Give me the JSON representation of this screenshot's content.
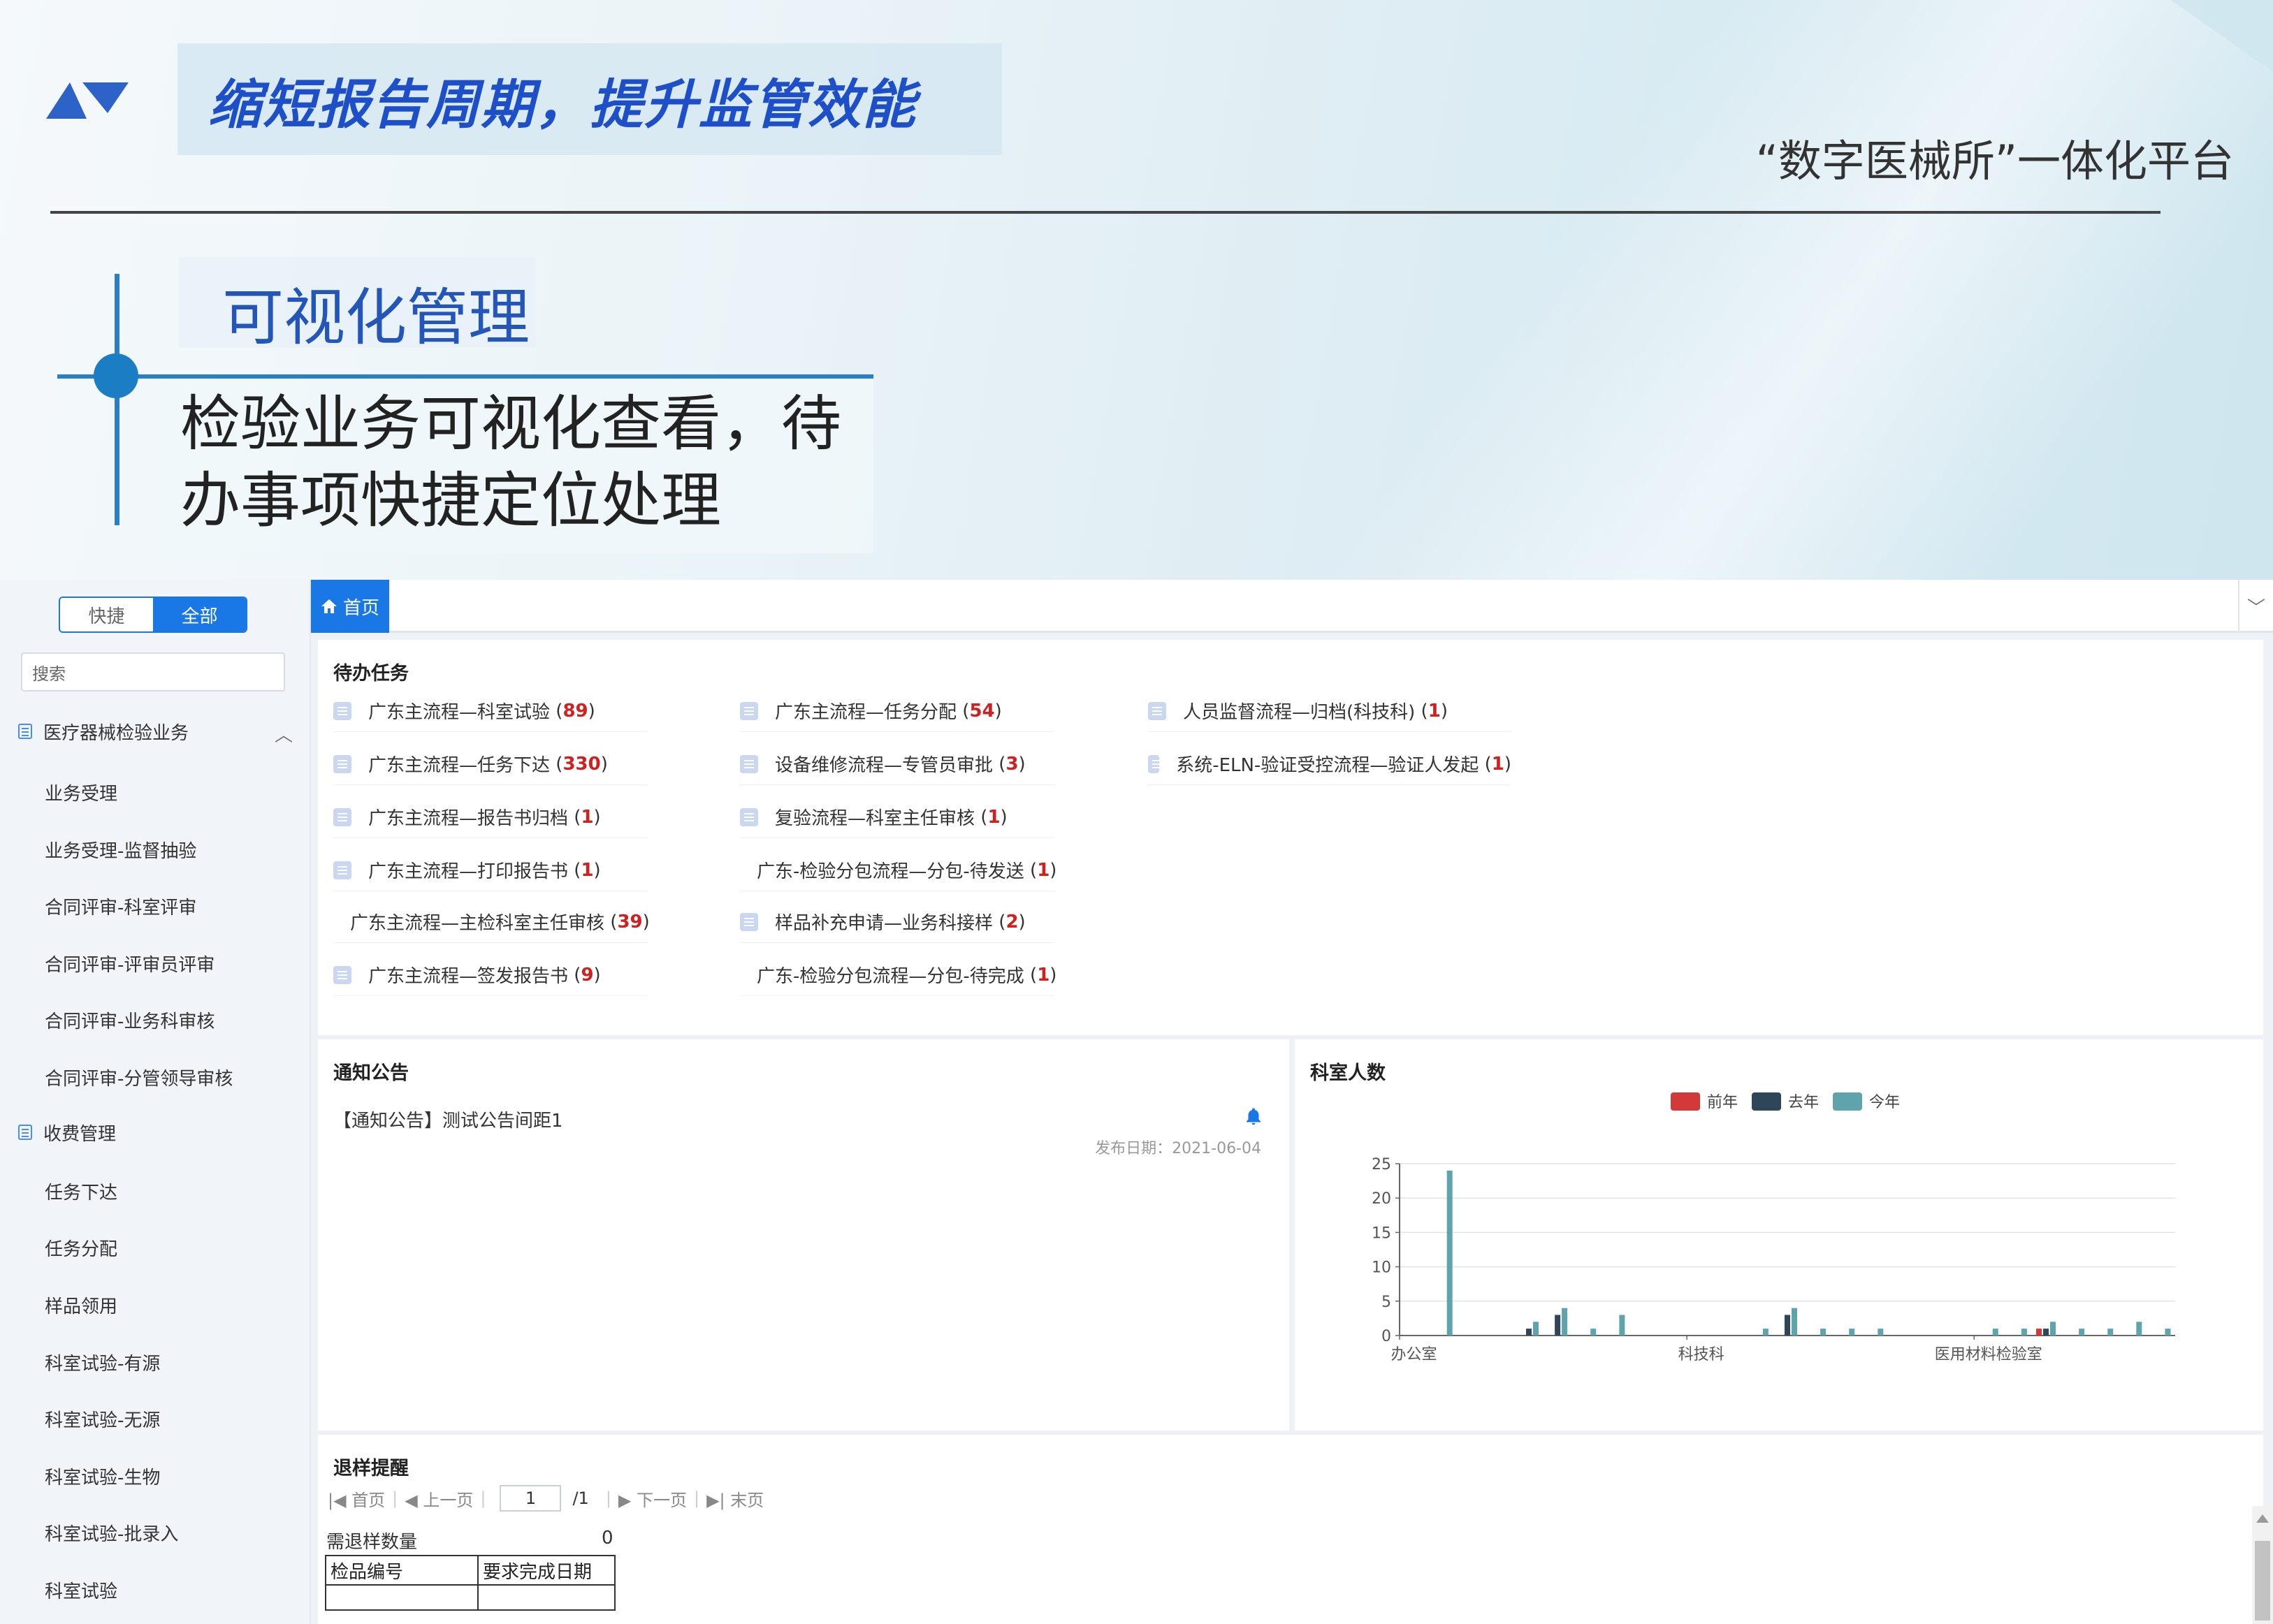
{
  "banner": {
    "slogan": "缩短报告周期，提升监管效能",
    "platform": "“数字医械所”一体化平台",
    "section_title": "可视化管理",
    "description": "检验业务可视化查看，待办事项快捷定位处理",
    "accent_color": "#1d4fc9"
  },
  "sidebar": {
    "toggle": {
      "quick": "快捷",
      "all": "全部"
    },
    "search_placeholder": "搜索",
    "groups": [
      {
        "label": "医疗器械检验业务",
        "icon": "document-icon",
        "items": [
          "业务受理",
          "业务受理-监督抽验",
          "合同评审-科室评审",
          "合同评审-评审员评审",
          "合同评审-业务科审核",
          "合同评审-分管领导审核"
        ]
      },
      {
        "label": "收费管理",
        "icon": "document-icon",
        "items": [
          "任务下达",
          "任务分配",
          "样品领用",
          "科室试验-有源",
          "科室试验-无源",
          "科室试验-生物",
          "科室试验-批录入",
          "科室试验"
        ]
      }
    ]
  },
  "tabs": {
    "home": "首页"
  },
  "todo": {
    "title": "待办任务",
    "items": [
      {
        "label": "广东主流程—科室试验",
        "count": "89"
      },
      {
        "label": "广东主流程—任务下达",
        "count": "330"
      },
      {
        "label": "广东主流程—报告书归档",
        "count": "1"
      },
      {
        "label": "广东主流程—打印报告书",
        "count": "1"
      },
      {
        "label": "广东主流程—主检科室主任审核",
        "count": "39"
      },
      {
        "label": "广东主流程—签发报告书",
        "count": "9"
      },
      {
        "label": "广东主流程—任务分配",
        "count": "54"
      },
      {
        "label": "设备维修流程—专管员审批",
        "count": "3"
      },
      {
        "label": "复验流程—科室主任审核",
        "count": "1"
      },
      {
        "label": "广东-检验分包流程—分包-待发送",
        "count": "1"
      },
      {
        "label": "样品补充申请—业务科接样",
        "count": "2"
      },
      {
        "label": "广东-检验分包流程—分包-待完成",
        "count": "1"
      },
      {
        "label": "人员监督流程—归档(科技科)",
        "count": "1"
      },
      {
        "label": "系统-ELN-验证受控流程—验证人发起",
        "count": "1"
      }
    ]
  },
  "notice": {
    "title": "通知公告",
    "item": "【通知公告】测试公告间距1",
    "date": "发布日期：2021-06-04"
  },
  "dept": {
    "title": "科室人数",
    "chart_data": {
      "type": "bar",
      "title": "科室人数",
      "legend_position": "top",
      "grid": true,
      "ylim": [
        0,
        25
      ],
      "yticks": [
        0,
        5,
        10,
        15,
        20,
        25
      ],
      "category_count": 27,
      "category_labels": [
        {
          "index": 0,
          "label": "办公室"
        },
        {
          "index": 10,
          "label": "科技科"
        },
        {
          "index": 20,
          "label": "医用材料检验室"
        }
      ],
      "series": [
        {
          "name": "前年",
          "color": "#d23a3a",
          "values": [
            0,
            0,
            0,
            0,
            0,
            0,
            0,
            0,
            0,
            0,
            0,
            0,
            0,
            0,
            0,
            0,
            0,
            0,
            0,
            0,
            0,
            0,
            1,
            0,
            0,
            0,
            0
          ]
        },
        {
          "name": "去年",
          "color": "#2f4558",
          "values": [
            0,
            0,
            0,
            0,
            1,
            3,
            0,
            0,
            0,
            0,
            0,
            0,
            0,
            3,
            0,
            0,
            0,
            0,
            0,
            0,
            0,
            0,
            1,
            0,
            0,
            0,
            0
          ]
        },
        {
          "name": "今年",
          "color": "#5fa3ad",
          "values": [
            0,
            24,
            0,
            0,
            2,
            4,
            1,
            3,
            0,
            0,
            0,
            0,
            1,
            4,
            1,
            1,
            1,
            0,
            0,
            0,
            1,
            1,
            2,
            1,
            1,
            2,
            1
          ]
        }
      ]
    }
  },
  "retreat": {
    "title": "退样提醒",
    "pager": {
      "first": "首页",
      "prev": "上一页",
      "page": "1",
      "total": "/1",
      "next": "下一页",
      "last": "末页"
    },
    "qty_label": "需退样数量",
    "qty_value": "0",
    "table_headers": [
      "检品编号",
      "要求完成日期"
    ]
  }
}
